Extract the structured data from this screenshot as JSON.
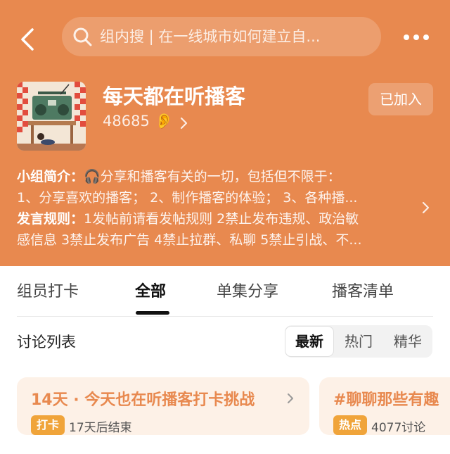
{
  "header": {
    "search_placeholder": "组内搜 | 在一线城市如何建立自...",
    "group_title": "每天都在听播客",
    "member_count": "48685",
    "join_status": "已加入",
    "intro_label": "小组简介：",
    "intro_line1": "🎧分享和播客有关的一切，包括但不限于：",
    "intro_line2": "1、分享喜欢的播客； 2、制作播客的体验； 3、各种播...",
    "rules_label": "发言规则：",
    "rules_line1": "1发帖前请看发帖规则 2禁止发布违规、政治敏",
    "rules_line2": "感信息 3禁止发布广告 4禁止拉群、私聊 5禁止引战、不..."
  },
  "tabs": [
    "组员打卡",
    "全部",
    "单集分享",
    "播客清单"
  ],
  "active_tab": "全部",
  "list": {
    "title": "讨论列表",
    "sort_options": [
      "最新",
      "热门",
      "精华"
    ],
    "active_sort": "最新"
  },
  "cards": [
    {
      "title": "14天 · 今天也在听播客打卡挑战",
      "badge": "打卡",
      "meta": "17天后结束"
    },
    {
      "title": "#聊聊那些有趣",
      "badge": "热点",
      "meta": "4077讨论"
    }
  ],
  "colors": {
    "accent": "#e8894f",
    "badge": "#f0a43a",
    "card_bg": "#fdf1e7"
  },
  "icons": [
    "back-arrow-icon",
    "search-icon",
    "more-icon",
    "ear-icon",
    "chevron-right-icon"
  ]
}
